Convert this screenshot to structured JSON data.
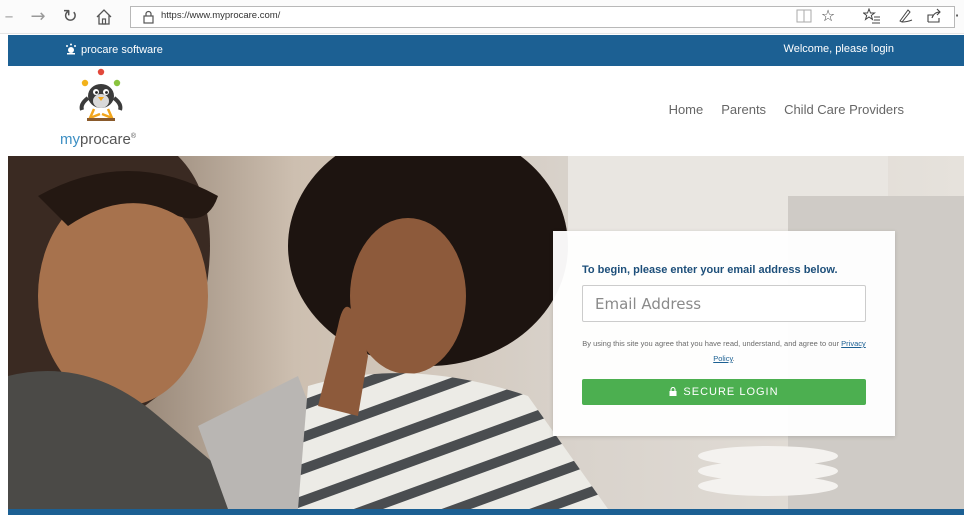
{
  "browser": {
    "url": "https://www.myprocare.com/",
    "icons": [
      "back-arrow-icon",
      "forward-arrow-icon",
      "refresh-icon",
      "home-icon",
      "reading-view-icon",
      "favorite-star-icon",
      "favorites-hub-icon",
      "pen-icon",
      "share-icon"
    ]
  },
  "topbar": {
    "brand": "procare software",
    "welcome": "Welcome, please login"
  },
  "header": {
    "logo_my": "my",
    "logo_procare": "procare",
    "logo_reg": "®",
    "nav": [
      "Home",
      "Parents",
      "Child Care Providers"
    ]
  },
  "login": {
    "title": "To begin, please enter your email address below.",
    "email_placeholder": "Email Address",
    "agree_text": "By using this site you agree that you have read, understand, and agree to our",
    "privacy_link": "Privacy Policy",
    "agree_end": ".",
    "button_label": "SECURE LOGIN"
  },
  "colors": {
    "brand_blue": "#1c6093",
    "title_blue": "#1d4f7a",
    "login_green": "#4caf50"
  }
}
